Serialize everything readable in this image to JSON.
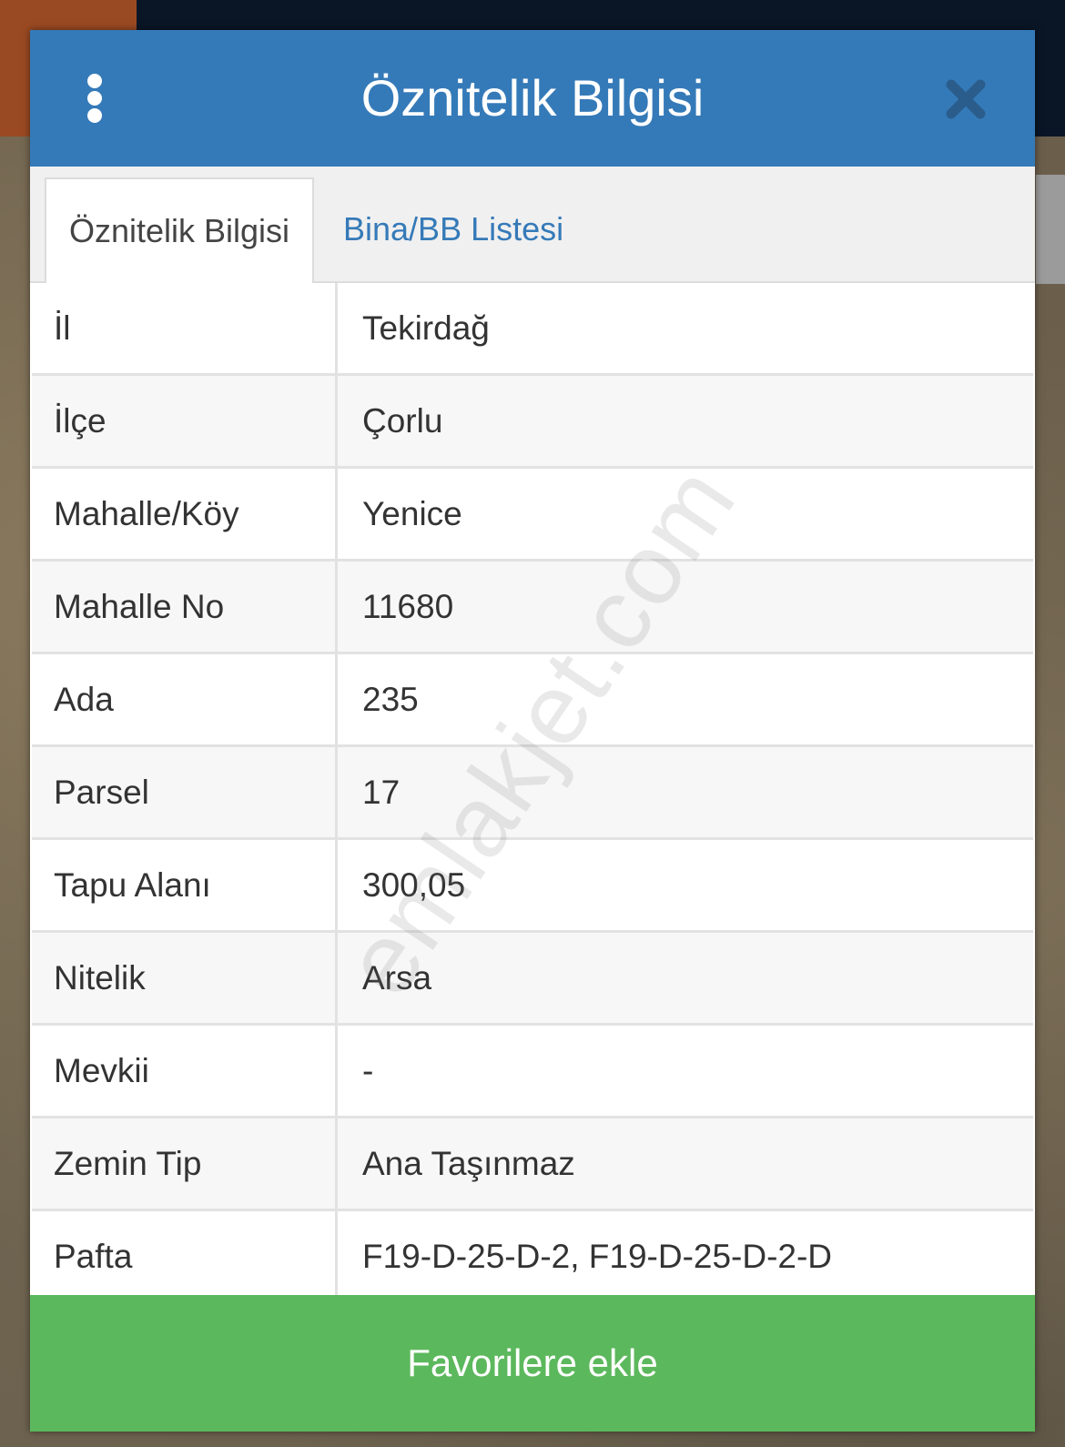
{
  "dialog": {
    "title": "Öznitelik Bilgisi",
    "header_color": "#357ab8"
  },
  "tabs": [
    {
      "label": "Öznitelik Bilgisi",
      "active": true
    },
    {
      "label": "Bina/BB Listesi",
      "active": false
    }
  ],
  "attributes": [
    {
      "label": "İl",
      "value": "Tekirdağ"
    },
    {
      "label": "İlçe",
      "value": "Çorlu"
    },
    {
      "label": "Mahalle/Köy",
      "value": "Yenice"
    },
    {
      "label": "Mahalle No",
      "value": "11680"
    },
    {
      "label": "Ada",
      "value": "235"
    },
    {
      "label": "Parsel",
      "value": "17"
    },
    {
      "label": "Tapu Alanı",
      "value": "300,05"
    },
    {
      "label": "Nitelik",
      "value": "Arsa"
    },
    {
      "label": "Mevkii",
      "value": "-"
    },
    {
      "label": "Zemin Tip",
      "value": "Ana Taşınmaz"
    },
    {
      "label": "Pafta",
      "value": "F19-D-25-D-2, F19-D-25-D-2-D"
    }
  ],
  "watermark": "emlakjet.com",
  "footer": {
    "favorite_label": "Favorilere ekle",
    "button_color": "#5cb85c"
  },
  "icons": {
    "menu": "vertical-ellipsis-icon",
    "close": "close-icon"
  }
}
